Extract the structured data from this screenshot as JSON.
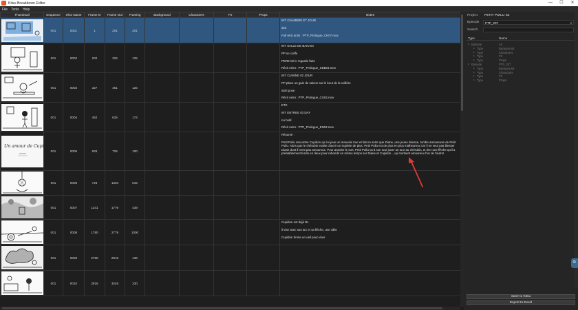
{
  "window": {
    "title": "Kitsu Breakdown Editor",
    "minimize_icon": "—",
    "maximize_icon": "☐",
    "close_icon": "✕"
  },
  "menu": [
    "File",
    "Tools",
    "Help"
  ],
  "table": {
    "columns": [
      "Thumbnail",
      "Sequence",
      "Shot Name",
      "Frame In",
      "Frame Out",
      "Framing",
      "Background",
      "Characters",
      "FX",
      "Props",
      "Notes"
    ],
    "rows": [
      {
        "sequence": "001",
        "shot": "0001",
        "frame_in": "1",
        "frame_out": "201",
        "framing": "201",
        "selected": true,
        "notes": "INT CHAMBRE ET JOUR\n\ndxd\n\nFull récit anim : PTP_Prologue_CH07.mov"
      },
      {
        "sequence": "001",
        "shot": "0002",
        "frame_in": "202",
        "frame_out": "326",
        "framing": "125",
        "selected": false,
        "notes": "INT SALLE DE BAIN 04\n\nPP se coiffe\n\nPERE 02 le regarde faire\n\nRécit Anim : PTP_Prologue_SDB04.mov"
      },
      {
        "sequence": "001",
        "shot": "0003",
        "frame_in": "327",
        "frame_out": "451",
        "framing": "125",
        "selected": false,
        "notes": "INT CUISINE 02 JOUR\n\nPP place un gain de saison sur le bout de la cuillère\n\nstart pose\n\nRécit Anim : PTP_Prologue_CU02.mov"
      },
      {
        "sequence": "001",
        "shot": "0004",
        "frame_in": "452",
        "frame_out": "625",
        "framing": "174",
        "selected": false,
        "notes": "ETE\n\nINT ENTREE 03 DAY\n\nno hold\n\nRécit Anim : PTP_Prologue_EN03.mov"
      },
      {
        "sequence": "001",
        "shot": "0005",
        "frame_in": "626",
        "frame_out": "725",
        "framing": "100",
        "selected": false,
        "notes": "Résumé :\n\nPetit Poilu rencontre Cupidon qui lui joue un mauvais tour et fait en sorte que Diane, une jeune déesse, tombe amoureuse de Petit Poilu. Alors que le chérubin exulte d'avoir un trophée de plus, Petit Poilu est de plus en plus malheureux car il ne veut pas blesser Diane dont il n'est pas amoureux. Pour annuler le sort, Petit Poilu va à son tour jouer un tour au chérubin, et tirer une flèche qu'il a préalablement fendu en deux pour rebondir en même temps sur Diane et Cupidon... qui tombent amoureux l'un de l'autre!"
      },
      {
        "sequence": "001",
        "shot": "0006",
        "frame_in": "726",
        "frame_out": "1340",
        "framing": "615",
        "selected": false,
        "notes": ""
      },
      {
        "sequence": "001",
        "shot": "0007",
        "frame_in": "1341",
        "frame_out": "1779",
        "framing": "439",
        "selected": false,
        "notes": ""
      },
      {
        "sequence": "001",
        "shot": "0008",
        "frame_in": "1780",
        "frame_out": "2779",
        "framing": "1000",
        "selected": false,
        "notes": "Cupidon est déjà RL\n\nil vise avec son arc et sa flèche, une cible\n\nCupidon ferme un oeil pour viser"
      },
      {
        "sequence": "001",
        "shot": "0009",
        "frame_in": "2780",
        "frame_out": "2915",
        "framing": "136",
        "selected": false,
        "notes": ""
      },
      {
        "sequence": "001",
        "shot": "0010",
        "frame_in": "2916",
        "frame_out": "3245",
        "framing": "330",
        "selected": false,
        "notes": ""
      }
    ]
  },
  "side": {
    "project_label": "Project",
    "project_value": "PETIT POILU S2",
    "episode_label": "Episode",
    "episode_value": "PTP_207",
    "search_label": "Search",
    "search_value": "",
    "tree_col_type": "Type",
    "tree_col_name": "Name",
    "tree": [
      {
        "indent": 0,
        "type": "Episode",
        "name": "All"
      },
      {
        "indent": 1,
        "type": "Type",
        "name": "Background"
      },
      {
        "indent": 1,
        "type": "Type",
        "name": "Characters"
      },
      {
        "indent": 1,
        "type": "Type",
        "name": "FX"
      },
      {
        "indent": 1,
        "type": "Type",
        "name": "Props"
      },
      {
        "indent": 0,
        "type": "Episode",
        "name": "PTP_207"
      },
      {
        "indent": 1,
        "type": "Type",
        "name": "Background"
      },
      {
        "indent": 1,
        "type": "Type",
        "name": "Characters"
      },
      {
        "indent": 1,
        "type": "Type",
        "name": "FX"
      },
      {
        "indent": 1,
        "type": "Type",
        "name": "Props"
      }
    ],
    "save_button": "Save to Kitsu",
    "export_button": "Export to Excel"
  },
  "thumb5_text": "Un amour de Cupidon",
  "colors": {
    "selection": "#30577f",
    "background": "#1e1e1e",
    "annotation": "#e03a3a"
  }
}
